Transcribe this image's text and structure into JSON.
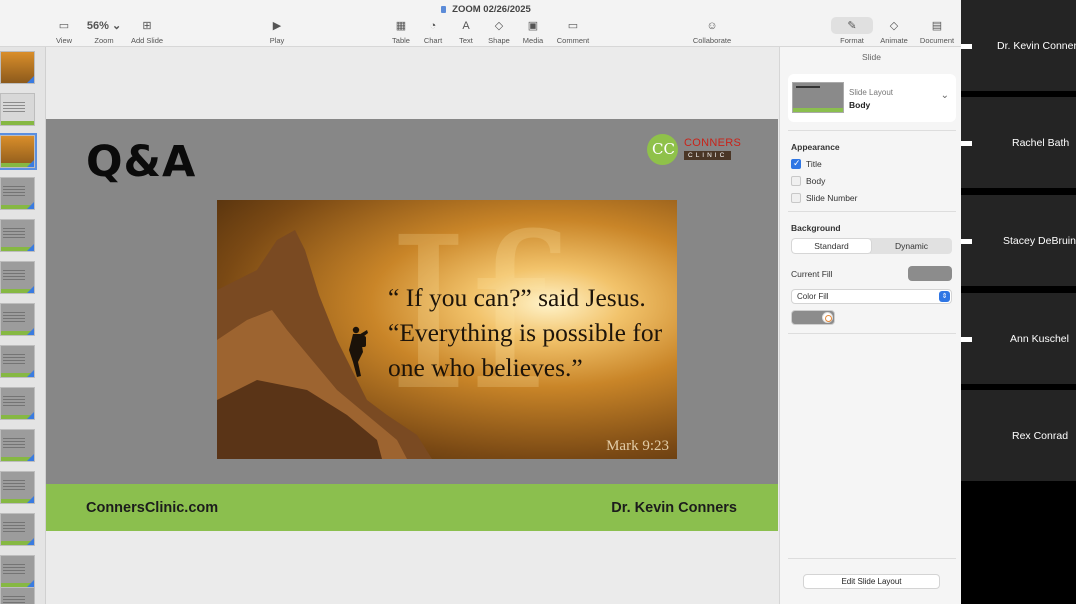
{
  "window": {
    "title": "ZOOM 02/26/2025"
  },
  "toolbar": {
    "view": "View",
    "zoom_value": "56%",
    "zoom": "Zoom",
    "add_slide": "Add Slide",
    "play": "Play",
    "table": "Table",
    "chart": "Chart",
    "text": "Text",
    "shape": "Shape",
    "media": "Media",
    "comment": "Comment",
    "collaborate": "Collaborate",
    "format": "Format",
    "animate": "Animate",
    "document": "Document"
  },
  "slide": {
    "title": "Q&A",
    "logo_monogram": "CC",
    "logo_word1": "CONNERS",
    "logo_word2": "CLINIC",
    "quote_ghost": "If",
    "quote_text": "“ If you can?” said Jesus. “Everything is possible for one who believes.”",
    "quote_ref": "Mark 9:23",
    "footer_left": "ConnersClinic.com",
    "footer_right": "Dr. Kevin Conners"
  },
  "inspector": {
    "tab": "Slide",
    "layout_caption": "Slide Layout",
    "layout_value": "Body",
    "appearance_heading": "Appearance",
    "appearance_options": [
      {
        "label": "Title",
        "checked": true
      },
      {
        "label": "Body",
        "checked": false
      },
      {
        "label": "Slide Number",
        "checked": false
      }
    ],
    "background_heading": "Background",
    "background_segments": [
      "Standard",
      "Dynamic"
    ],
    "background_selected": "Standard",
    "current_fill_label": "Current Fill",
    "fill_type": "Color Fill",
    "fill_color": "#8c8c8c",
    "edit_layout_button": "Edit Slide Layout"
  },
  "participants": [
    "Dr. Kevin Conners",
    "Rachel Bath",
    "Stacey DeBruin",
    "Ann Kuschel",
    "Rex Conrad"
  ],
  "colors": {
    "accent_green": "#8bbf4e",
    "slide_bg": "#878787",
    "selection_blue": "#2f76e4"
  }
}
